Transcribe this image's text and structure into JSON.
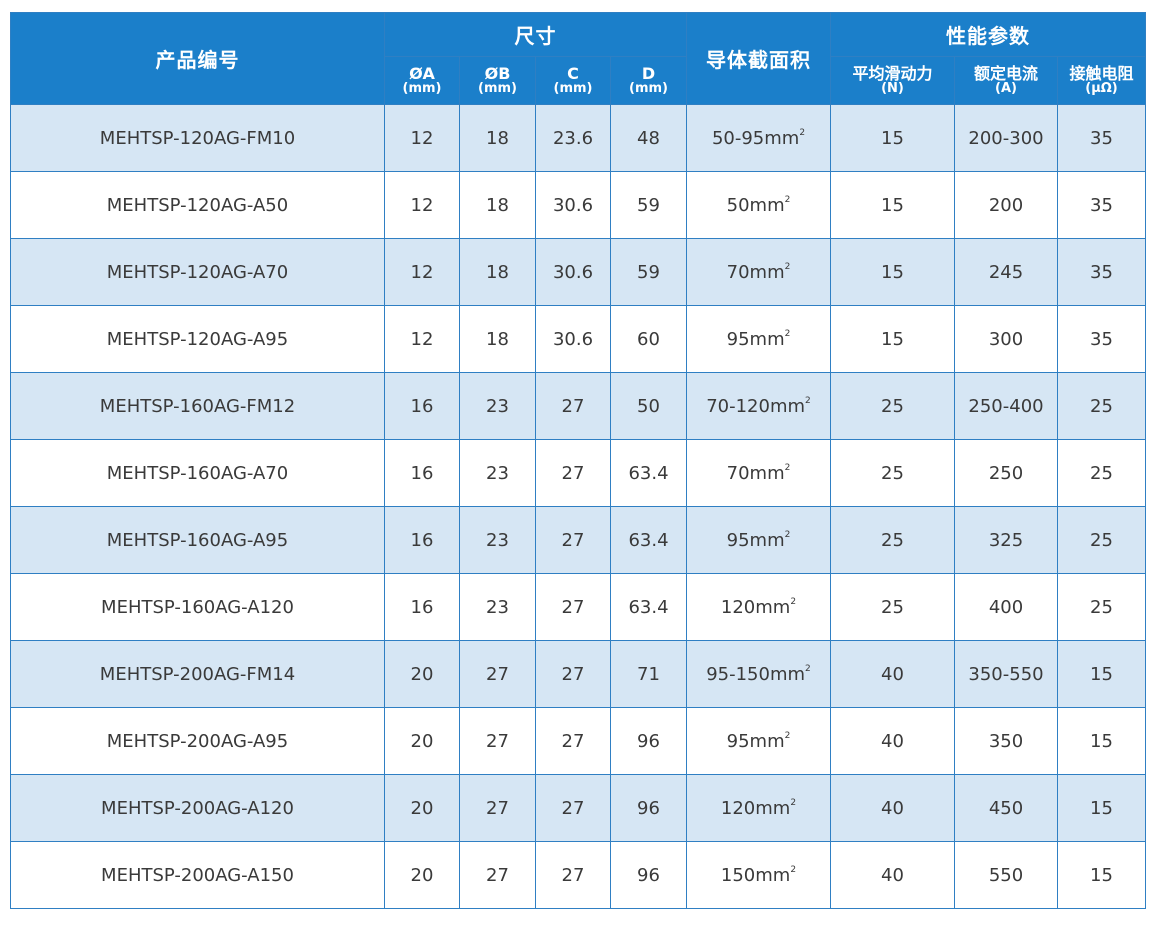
{
  "header": {
    "product_no": "产品编号",
    "dimensions": "尺寸",
    "conductor_area": "导体截面积",
    "performance": "性能参数",
    "sub": [
      {
        "name": "ØA",
        "unit": "(mm)"
      },
      {
        "name": "ØB",
        "unit": "(mm)"
      },
      {
        "name": "C",
        "unit": "(mm)"
      },
      {
        "name": "D",
        "unit": "(mm)"
      },
      {
        "name": "平均滑动力",
        "unit": "(N)"
      },
      {
        "name": "额定电流",
        "unit": "(A)"
      },
      {
        "name": "接触电阻",
        "unit": "(μΩ)"
      }
    ]
  },
  "area_unit": "mm",
  "area_sup": "2",
  "rows": [
    {
      "model": "MEHTSP-120AG-FM10",
      "a": "12",
      "b": "18",
      "c": "23.6",
      "d": "48",
      "area": "50-95",
      "force": "15",
      "current": "200-300",
      "resistance": "35"
    },
    {
      "model": "MEHTSP-120AG-A50",
      "a": "12",
      "b": "18",
      "c": "30.6",
      "d": "59",
      "area": "50",
      "force": "15",
      "current": "200",
      "resistance": "35"
    },
    {
      "model": "MEHTSP-120AG-A70",
      "a": "12",
      "b": "18",
      "c": "30.6",
      "d": "59",
      "area": "70",
      "force": "15",
      "current": "245",
      "resistance": "35"
    },
    {
      "model": "MEHTSP-120AG-A95",
      "a": "12",
      "b": "18",
      "c": "30.6",
      "d": "60",
      "area": "95",
      "force": "15",
      "current": "300",
      "resistance": "35"
    },
    {
      "model": "MEHTSP-160AG-FM12",
      "a": "16",
      "b": "23",
      "c": "27",
      "d": "50",
      "area": "70-120",
      "force": "25",
      "current": "250-400",
      "resistance": "25"
    },
    {
      "model": "MEHTSP-160AG-A70",
      "a": "16",
      "b": "23",
      "c": "27",
      "d": "63.4",
      "area": "70",
      "force": "25",
      "current": "250",
      "resistance": "25"
    },
    {
      "model": "MEHTSP-160AG-A95",
      "a": "16",
      "b": "23",
      "c": "27",
      "d": "63.4",
      "area": "95",
      "force": "25",
      "current": "325",
      "resistance": "25"
    },
    {
      "model": "MEHTSP-160AG-A120",
      "a": "16",
      "b": "23",
      "c": "27",
      "d": "63.4",
      "area": "120",
      "force": "25",
      "current": "400",
      "resistance": "25"
    },
    {
      "model": "MEHTSP-200AG-FM14",
      "a": "20",
      "b": "27",
      "c": "27",
      "d": "71",
      "area": "95-150",
      "force": "40",
      "current": "350-550",
      "resistance": "15"
    },
    {
      "model": "MEHTSP-200AG-A95",
      "a": "20",
      "b": "27",
      "c": "27",
      "d": "96",
      "area": "95",
      "force": "40",
      "current": "350",
      "resistance": "15"
    },
    {
      "model": "MEHTSP-200AG-A120",
      "a": "20",
      "b": "27",
      "c": "27",
      "d": "96",
      "area": "120",
      "force": "40",
      "current": "450",
      "resistance": "15"
    },
    {
      "model": "MEHTSP-200AG-A150",
      "a": "20",
      "b": "27",
      "c": "27",
      "d": "96",
      "area": "150",
      "force": "40",
      "current": "550",
      "resistance": "15"
    }
  ],
  "colors": {
    "header_bg": "#1b7fca",
    "header_text": "#ffffff",
    "row_alt_bg": "#d6e6f4",
    "border": "#2f7fc3"
  }
}
